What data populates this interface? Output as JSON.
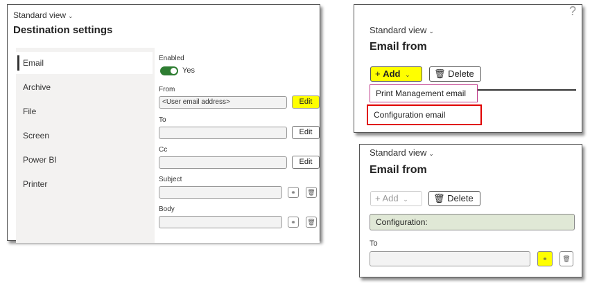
{
  "panel1": {
    "view_label": "Standard view",
    "title": "Destination settings",
    "nav": [
      "Email",
      "Archive",
      "File",
      "Screen",
      "Power BI",
      "Printer"
    ],
    "enabled_label": "Enabled",
    "enabled_value": "Yes",
    "from_label": "From",
    "from_value": "<User email address>",
    "to_label": "To",
    "cc_label": "Cc",
    "subject_label": "Subject",
    "body_label": "Body",
    "edit_label": "Edit",
    "enabled_on": true
  },
  "panel2": {
    "help_glyph": "?",
    "view_label": "Standard view",
    "title": "Email from",
    "add_label": "Add",
    "delete_label": "Delete",
    "dropdown": [
      "Print Management email",
      "Configuration email"
    ]
  },
  "panel3": {
    "view_label": "Standard view",
    "title": "Email from",
    "add_label": "Add",
    "delete_label": "Delete",
    "config_value": "Configuration:",
    "to_label": "To"
  },
  "colors": {
    "highlight_yellow": "#ffff00",
    "toggle_green": "#2e7d32",
    "callout_red": "#e00000",
    "dropdown_border": "#c03a8a",
    "config_fill": "#e0e8d6"
  },
  "icons": [
    "chevron-down-icon",
    "plus-icon",
    "trash-icon",
    "link-icon",
    "help-icon"
  ]
}
